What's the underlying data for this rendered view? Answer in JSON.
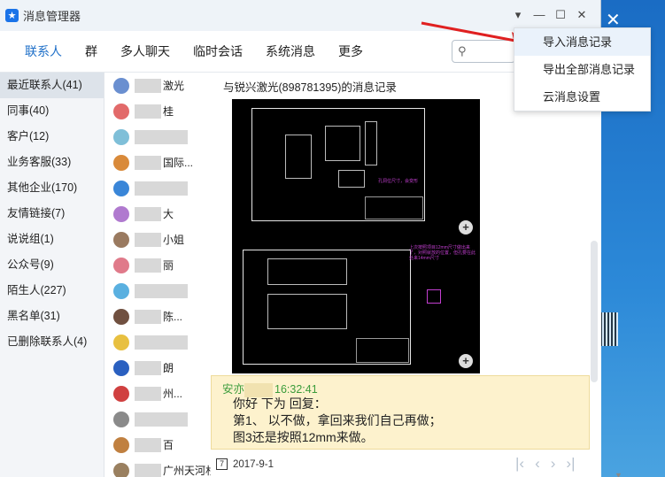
{
  "window": {
    "title": "消息管理器",
    "controls": [
      "▾",
      "—",
      "☐",
      "✕"
    ]
  },
  "nav": {
    "tabs": [
      "联系人",
      "群",
      "多人聊天",
      "临时会话",
      "系统消息",
      "更多"
    ],
    "active_tab": "联系人"
  },
  "categories": [
    "最近联系人(41)",
    "同事(40)",
    "客户(12)",
    "业务客服(33)",
    "其他企业(170)",
    "友情链接(7)",
    "说说组(1)",
    "公众号(9)",
    "陌生人(227)",
    "黑名单(31)",
    "已删除联系人(4)"
  ],
  "contacts": [
    {
      "visible_text": "激光",
      "color": "#6a8fd0"
    },
    {
      "visible_text": "桂",
      "color": "#e26a6a"
    },
    {
      "visible_text": "",
      "color": "#7fbfd8"
    },
    {
      "visible_text": "国际...",
      "color": "#d98a3a"
    },
    {
      "visible_text": "",
      "color": "#3a86d8"
    },
    {
      "visible_text": "大",
      "color": "#b07acf"
    },
    {
      "visible_text": "小姐",
      "color": "#9a7a60"
    },
    {
      "visible_text": "丽",
      "color": "#e07a8a"
    },
    {
      "visible_text": "",
      "color": "#5ab0e0"
    },
    {
      "visible_text": "陈...",
      "color": "#705040"
    },
    {
      "visible_text": "",
      "color": "#e8c040"
    },
    {
      "visible_text": "朗",
      "color": "#2a60c0"
    },
    {
      "visible_text": "州...",
      "color": "#d04040"
    },
    {
      "visible_text": "",
      "color": "#8a8a8a"
    },
    {
      "visible_text": "百",
      "color": "#c08040"
    },
    {
      "visible_text": "广州天河杉...",
      "color": "#9a8060"
    }
  ],
  "messages": {
    "header": "与锐兴激光(898781395)的消息记录",
    "cad_notes": [
      "孔洞位尺寸，会变形",
      "上次按照项目12mm尺寸做出来了，对照就放的位置，但孔要在此处来14mm尺寸"
    ],
    "reply_sender": "安亦",
    "reply_time": "16:32:41",
    "reply_lines": [
      "你好 下为 回复：",
      "第1、 以不做，拿回来我们自己再做；",
      "图3还是按照12mm来做。"
    ],
    "date": "2017-9-1",
    "calendar_glyph": "7"
  },
  "menu": {
    "items": [
      "导入消息记录",
      "导出全部消息记录",
      "云消息设置"
    ]
  },
  "icons": {
    "app": "chat-star-icon",
    "search": "search-icon",
    "pager": [
      "|‹",
      "‹",
      "›",
      "›|"
    ]
  },
  "colors": {
    "accent": "#1e6fc8",
    "reply_bg": "#fdf2cd",
    "sender_green": "#3b9c3b",
    "arrow_red": "#e02020"
  }
}
